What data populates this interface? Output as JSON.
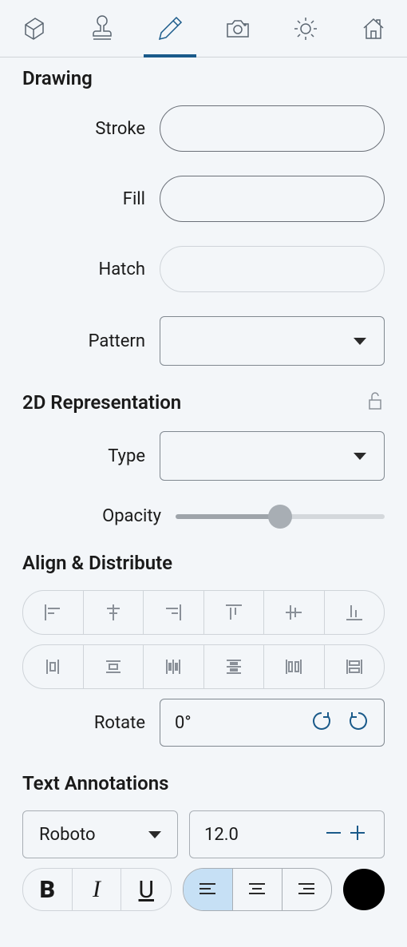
{
  "sections": {
    "drawing": {
      "title": "Drawing",
      "stroke_label": "Stroke",
      "fill_label": "Fill",
      "hatch_label": "Hatch",
      "pattern_label": "Pattern"
    },
    "representation": {
      "title": "2D Representation",
      "type_label": "Type",
      "opacity_label": "Opacity",
      "opacity_value": 50
    },
    "align": {
      "title": "Align & Distribute",
      "rotate_label": "Rotate",
      "rotate_value": "0°"
    },
    "text": {
      "title": "Text Annotations",
      "font_family": "Roboto",
      "font_size": "12.0",
      "bold": "B",
      "italic": "I",
      "underline": "U",
      "color": "#000000"
    }
  }
}
